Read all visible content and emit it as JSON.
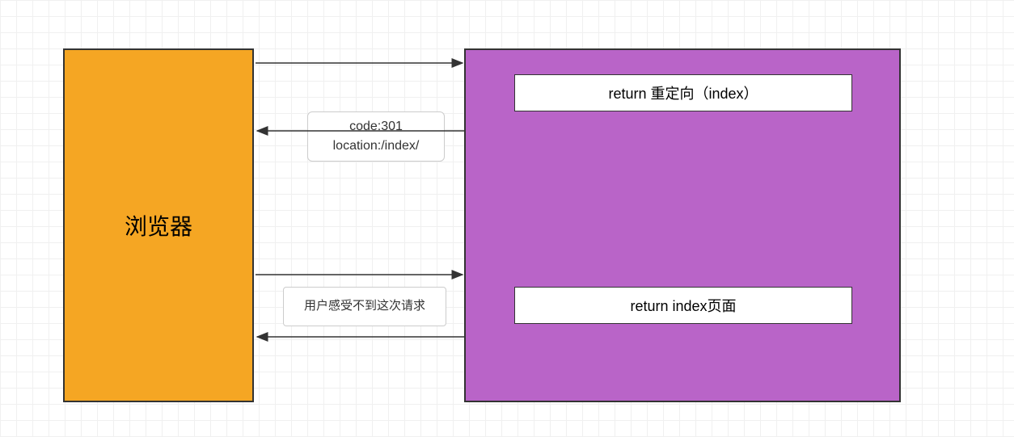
{
  "browser": {
    "label": "浏览器"
  },
  "server": {
    "redirect_label": "return 重定向（index）",
    "index_label": "return index页面"
  },
  "arrows": {
    "response301": {
      "line1": "code:301",
      "line2": "location:/index/"
    },
    "user_note": "用户感受不到这次请求"
  },
  "colors": {
    "browser_bg": "#f5a623",
    "server_bg": "#b964c8",
    "border": "#333333"
  }
}
